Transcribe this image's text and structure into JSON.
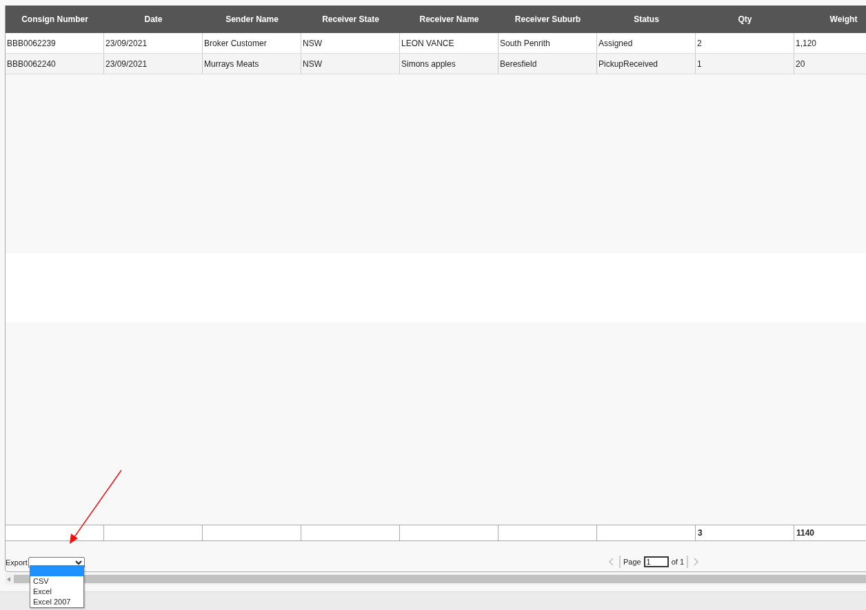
{
  "table": {
    "columns": [
      "Consign Number",
      "Date",
      "Sender Name",
      "Receiver State",
      "Receiver Name",
      "Receiver Suburb",
      "Status",
      "Qty",
      "Weight"
    ],
    "rows": [
      [
        "BBB0062239",
        "23/09/2021",
        "Broker Customer",
        "NSW",
        "LEON VANCE",
        "South Penrith",
        "Assigned",
        "2",
        "1,120"
      ],
      [
        "BBB0062240",
        "23/09/2021",
        "Murrays Meats",
        "NSW",
        "Simons apples",
        "Beresfield",
        "PickupReceived",
        "1",
        "20"
      ]
    ],
    "totals": [
      {
        "kind": "empty"
      },
      {
        "kind": "empty"
      },
      {
        "kind": "empty"
      },
      {
        "kind": "empty"
      },
      {
        "kind": "empty"
      },
      {
        "kind": "empty"
      },
      {
        "kind": "empty"
      },
      {
        "kind": "value",
        "text": "3"
      },
      {
        "kind": "value",
        "text": "1140"
      }
    ]
  },
  "export": {
    "label": "Export",
    "options": [
      {
        "selected": true
      },
      {
        "label": "CSV",
        "selected": false
      },
      {
        "label": "Excel",
        "selected": false
      },
      {
        "label": "Excel 2007",
        "selected": false
      }
    ]
  },
  "pager": {
    "label": "Page",
    "value": "1",
    "of": "of 1",
    "prev_disabled": true,
    "next_disabled": true
  }
}
